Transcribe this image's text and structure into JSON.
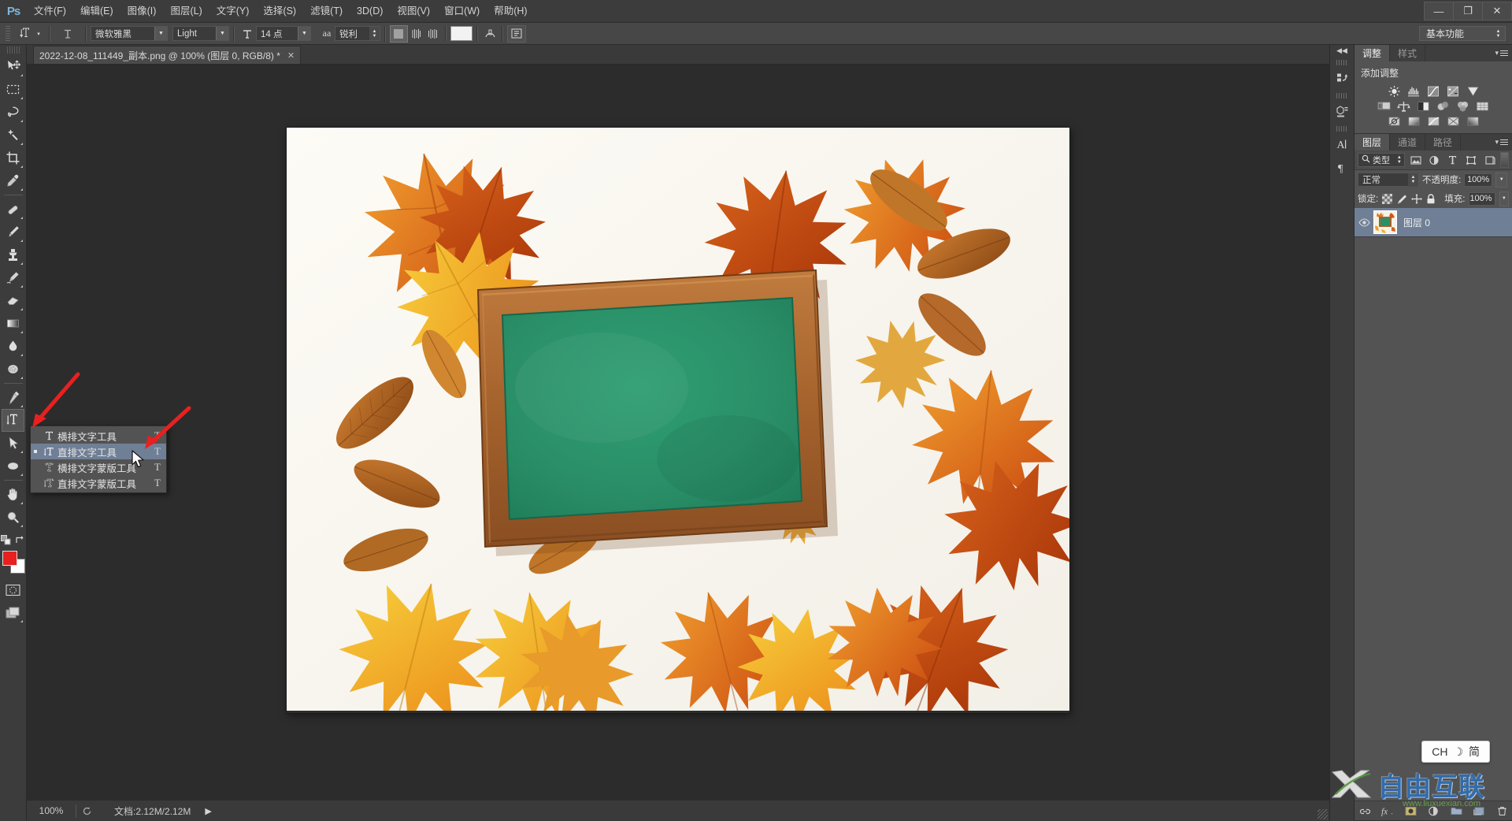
{
  "app": {
    "logo": "Ps",
    "menus": [
      {
        "label": "文件(F)",
        "name": "menu-file"
      },
      {
        "label": "编辑(E)",
        "name": "menu-edit"
      },
      {
        "label": "图像(I)",
        "name": "menu-image"
      },
      {
        "label": "图层(L)",
        "name": "menu-layer"
      },
      {
        "label": "文字(Y)",
        "name": "menu-type"
      },
      {
        "label": "选择(S)",
        "name": "menu-select"
      },
      {
        "label": "滤镜(T)",
        "name": "menu-filter"
      },
      {
        "label": "3D(D)",
        "name": "menu-3d"
      },
      {
        "label": "视图(V)",
        "name": "menu-view"
      },
      {
        "label": "窗口(W)",
        "name": "menu-window"
      },
      {
        "label": "帮助(H)",
        "name": "menu-help"
      }
    ],
    "window_controls": {
      "minimize": "—",
      "restore": "❐",
      "close": "✕"
    }
  },
  "options_bar": {
    "tool_preset_icon": "vertical-type-tool-icon",
    "orientation_icon": "toggle-text-orientation-icon",
    "font_family": "微软雅黑",
    "font_style": "Light",
    "font_size": "14 点",
    "antialias_icon_label": "aa",
    "antialias": "锐利",
    "align_left": "align-text-left-icon",
    "align_center": "align-text-center-icon",
    "align_right": "align-text-right-icon",
    "color_swatch": "#f2f2f2",
    "warp_icon": "warp-text-icon",
    "panels_icon": "toggle-character-paragraph-panels-icon",
    "workspace": "基本功能"
  },
  "toolbar": {
    "tools": [
      {
        "name": "move-tool",
        "glyph": "move"
      },
      {
        "name": "rectangular-marquee-tool",
        "glyph": "marquee"
      },
      {
        "name": "lasso-tool",
        "glyph": "lasso"
      },
      {
        "name": "magic-wand-tool",
        "glyph": "wand"
      },
      {
        "name": "crop-tool",
        "glyph": "crop"
      },
      {
        "name": "eyedropper-tool",
        "glyph": "eyedropper"
      },
      {
        "name": "spot-healing-brush-tool",
        "glyph": "healing"
      },
      {
        "name": "brush-tool",
        "glyph": "brush"
      },
      {
        "name": "clone-stamp-tool",
        "glyph": "stamp"
      },
      {
        "name": "history-brush-tool",
        "glyph": "historybrush"
      },
      {
        "name": "eraser-tool",
        "glyph": "eraser"
      },
      {
        "name": "gradient-tool",
        "glyph": "gradient"
      },
      {
        "name": "blur-tool",
        "glyph": "blur"
      },
      {
        "name": "dodge-tool",
        "glyph": "dodge"
      },
      {
        "name": "pen-tool",
        "glyph": "pen"
      },
      {
        "name": "vertical-type-tool",
        "glyph": "type",
        "active": true
      },
      {
        "name": "path-selection-tool",
        "glyph": "pathselect"
      },
      {
        "name": "ellipse-shape-tool",
        "glyph": "ellipse"
      },
      {
        "name": "hand-tool",
        "glyph": "hand"
      },
      {
        "name": "zoom-tool",
        "glyph": "zoom"
      }
    ],
    "foreground_color": "#e8201f",
    "background_color": "#ffffff",
    "quick_mask_name": "quick-mask-toggle",
    "screen_mode_name": "screen-mode-toggle"
  },
  "flyout_menu": {
    "items": [
      {
        "label": "横排文字工具",
        "shortcut": "T",
        "icon": "horizontal-type-icon",
        "selected": false
      },
      {
        "label": "直排文字工具",
        "shortcut": "T",
        "icon": "vertical-type-icon",
        "selected": true
      },
      {
        "label": "横排文字蒙版工具",
        "shortcut": "T",
        "icon": "horizontal-type-mask-icon",
        "selected": false
      },
      {
        "label": "直排文字蒙版工具",
        "shortcut": "T",
        "icon": "vertical-type-mask-icon",
        "selected": false
      }
    ]
  },
  "document": {
    "tab_title": "2022-12-08_111449_副本.png @ 100% (图层 0, RGB/8) *",
    "close_glyph": "✕"
  },
  "status_bar": {
    "zoom": "100%",
    "doc_info": "文档:2.12M/2.12M",
    "arrow": "▶"
  },
  "right_rail": {
    "collapse_glyph": "◀◀",
    "icons": [
      {
        "name": "history-panel-icon"
      },
      {
        "name": "3d-panel-icon"
      },
      {
        "name": "character-panel-icon"
      },
      {
        "name": "paragraph-panel-icon"
      }
    ]
  },
  "adjustments_panel": {
    "tabs": [
      {
        "label": "调整",
        "active": true
      },
      {
        "label": "样式",
        "active": false
      }
    ],
    "title": "添加调整",
    "row1": [
      {
        "name": "brightness-contrast-icon"
      },
      {
        "name": "levels-icon"
      },
      {
        "name": "curves-icon"
      },
      {
        "name": "exposure-icon"
      },
      {
        "name": "vibrance-icon"
      }
    ],
    "row2": [
      {
        "name": "hue-saturation-icon"
      },
      {
        "name": "color-balance-icon"
      },
      {
        "name": "black-white-icon"
      },
      {
        "name": "photo-filter-icon"
      },
      {
        "name": "channel-mixer-icon"
      },
      {
        "name": "color-lookup-icon"
      }
    ],
    "row3": [
      {
        "name": "invert-icon"
      },
      {
        "name": "posterize-icon"
      },
      {
        "name": "threshold-icon"
      },
      {
        "name": "gradient-map-icon"
      },
      {
        "name": "selective-color-icon"
      }
    ]
  },
  "layers_panel": {
    "tabs": [
      {
        "label": "图层",
        "active": true
      },
      {
        "label": "通道",
        "active": false
      },
      {
        "label": "路径",
        "active": false
      }
    ],
    "filter_label": "类型",
    "filter_icons": [
      {
        "name": "filter-pixel-layers-icon"
      },
      {
        "name": "filter-adjustment-layers-icon"
      },
      {
        "name": "filter-type-layers-icon"
      },
      {
        "name": "filter-shape-layers-icon"
      },
      {
        "name": "filter-smart-object-icon"
      }
    ],
    "blend_mode": "正常",
    "opacity_label": "不透明度:",
    "opacity_value": "100%",
    "lock_label": "锁定:",
    "lock_icons": [
      {
        "name": "lock-transparent-pixels-icon"
      },
      {
        "name": "lock-image-pixels-icon"
      },
      {
        "name": "lock-position-icon"
      },
      {
        "name": "lock-all-icon"
      }
    ],
    "fill_label": "填充:",
    "fill_value": "100%",
    "layers": [
      {
        "name": "图层 0",
        "visible": true,
        "selected": true
      }
    ],
    "footer_icons": [
      {
        "name": "link-layers-icon"
      },
      {
        "name": "layer-style-fx-icon"
      },
      {
        "name": "add-layer-mask-icon"
      },
      {
        "name": "new-adjustment-layer-icon"
      },
      {
        "name": "new-group-icon"
      },
      {
        "name": "new-layer-icon"
      },
      {
        "name": "delete-layer-icon"
      }
    ]
  },
  "ime_indicator": {
    "lang": "CH",
    "moon": "☽",
    "mode": "简"
  },
  "watermark": {
    "text": "自由互联",
    "url": "www.liuxuexian.com"
  }
}
